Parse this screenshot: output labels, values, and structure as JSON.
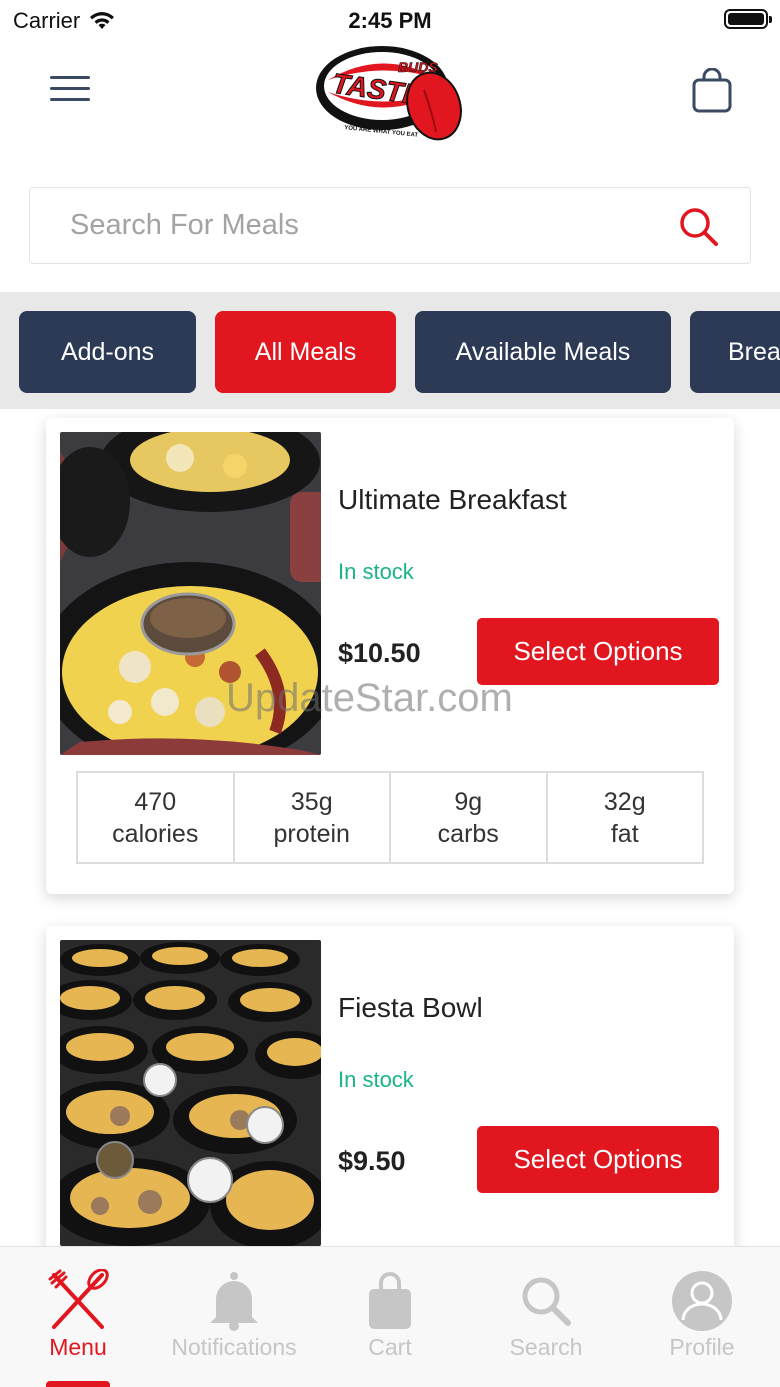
{
  "status_bar": {
    "carrier": "Carrier",
    "time": "2:45 PM"
  },
  "header": {
    "logo_text": "TASTE BUDS",
    "logo_tagline": "YOU ARE WHAT YOU EAT"
  },
  "search": {
    "placeholder": "Search For Meals"
  },
  "categories": [
    {
      "label": "Add-ons",
      "active": false
    },
    {
      "label": "All Meals",
      "active": true
    },
    {
      "label": "Available Meals",
      "active": false
    },
    {
      "label": "Brea",
      "active": false
    }
  ],
  "meals": [
    {
      "name": "Ultimate Breakfast",
      "stock": "In stock",
      "price": "$10.50",
      "button": "Select Options",
      "nutrition": [
        {
          "value": "470",
          "unit": "calories"
        },
        {
          "value": "35g",
          "unit": "protein"
        },
        {
          "value": "9g",
          "unit": "carbs"
        },
        {
          "value": "32g",
          "unit": "fat"
        }
      ]
    },
    {
      "name": "Fiesta Bowl",
      "stock": "In stock",
      "price": "$9.50",
      "button": "Select Options"
    }
  ],
  "watermark": "UpdateStar.com",
  "tabs": [
    {
      "label": "Menu",
      "icon": "utensils-icon",
      "active": true
    },
    {
      "label": "Notifications",
      "icon": "bell-icon",
      "active": false
    },
    {
      "label": "Cart",
      "icon": "shopping-bag-icon",
      "active": false
    },
    {
      "label": "Search",
      "icon": "search-icon",
      "active": false
    },
    {
      "label": "Profile",
      "icon": "user-icon",
      "active": false
    }
  ],
  "colors": {
    "accent": "#e1161f",
    "navy": "#2c3a55",
    "stock": "#1bb388",
    "inactive_tab": "#c6c6c6"
  }
}
